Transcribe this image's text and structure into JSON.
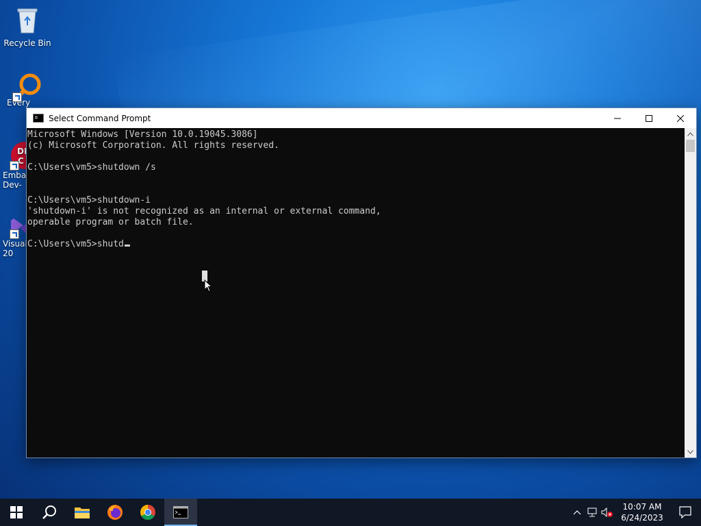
{
  "desktop": {
    "icons": [
      {
        "label": "Recycle Bin"
      },
      {
        "label": "Every"
      },
      {
        "label": "Embar\nDev-"
      },
      {
        "label": "Visual\n20"
      }
    ]
  },
  "window": {
    "title": "Select Command Prompt",
    "console_lines": [
      "Microsoft Windows [Version 10.0.19045.3086]",
      "(c) Microsoft Corporation. All rights reserved.",
      "",
      "C:\\Users\\vm5>shutdown /s",
      "",
      "",
      "C:\\Users\\vm5>shutdown-i",
      "'shutdown-i' is not recognized as an internal or external command,",
      "operable program or batch file.",
      "",
      "C:\\Users\\vm5>shutd"
    ]
  },
  "taskbar": {
    "items": [
      "windows-start-icon",
      "search-icon",
      "file-explorer-icon",
      "firefox-icon",
      "chrome-icon",
      "command-prompt-icon"
    ],
    "clock": {
      "time": "10:07 AM",
      "date": "6/24/2023"
    }
  },
  "colors": {
    "console_bg": "#0c0c0c",
    "console_fg": "#cccccc",
    "taskbar_bg": "#101725"
  }
}
